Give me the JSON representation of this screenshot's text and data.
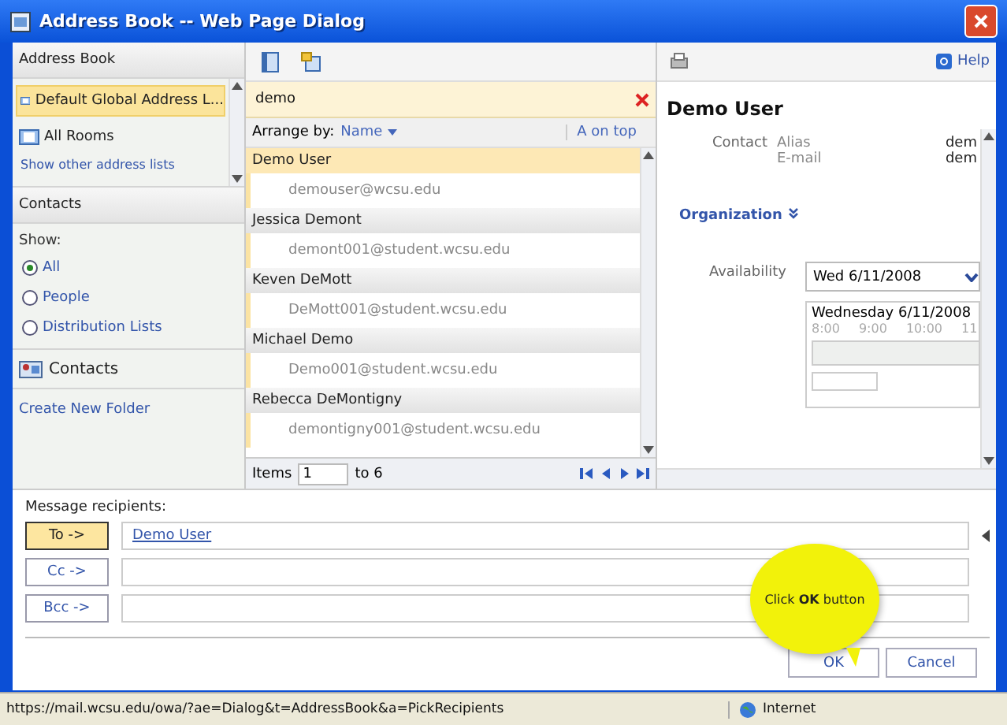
{
  "window": {
    "title": "Address Book -- Web Page Dialog"
  },
  "address_book": {
    "header": "Address Book",
    "lists": [
      {
        "label": "Default Global Address L...",
        "selected": true
      },
      {
        "label": "All Rooms",
        "selected": false
      }
    ],
    "more_link": "Show other address lists"
  },
  "contacts": {
    "header": "Contacts",
    "show_label": "Show:",
    "filters": [
      {
        "label": "All",
        "selected": true
      },
      {
        "label": "People",
        "selected": false
      },
      {
        "label": "Distribution Lists",
        "selected": false
      }
    ],
    "folder": "Contacts",
    "create_link": "Create New Folder"
  },
  "search": {
    "value": "demo"
  },
  "arrange": {
    "label": "Arrange by:",
    "field": "Name",
    "order": "A on top"
  },
  "results": [
    {
      "name": "Demo User",
      "email": "demouser@wcsu.edu",
      "selected": true
    },
    {
      "name": "Jessica Demont",
      "email": "demont001@student.wcsu.edu",
      "selected": false
    },
    {
      "name": "Keven DeMott",
      "email": "DeMott001@student.wcsu.edu",
      "selected": false
    },
    {
      "name": "Michael Demo",
      "email": "Demo001@student.wcsu.edu",
      "selected": false
    },
    {
      "name": "Rebecca DeMontigny",
      "email": "demontigny001@student.wcsu.edu",
      "selected": false
    }
  ],
  "pager": {
    "label": "Items",
    "value": "1",
    "range": "to 6"
  },
  "detail": {
    "help": "Help",
    "name": "Demo User",
    "contact_label": "Contact",
    "fields": [
      {
        "label": "Alias",
        "value": "dem"
      },
      {
        "label": "E-mail",
        "value": "dem"
      }
    ],
    "organization": "Organization",
    "availability_label": "Availability",
    "date": "Wed 6/11/2008",
    "day": "Wednesday 6/11/2008",
    "times": [
      "8:00",
      "9:00",
      "10:00",
      "11"
    ]
  },
  "recipients": {
    "label": "Message recipients:",
    "rows": [
      {
        "button": "To ->",
        "selected": true,
        "entries": [
          "Demo User"
        ]
      },
      {
        "button": "Cc ->",
        "selected": false
      },
      {
        "button": "Bcc ->",
        "selected": false
      }
    ]
  },
  "buttons": [
    {
      "label": "OK"
    },
    {
      "label": "Cancel"
    }
  ],
  "tooltip": {
    "text": "Click **OK** button"
  },
  "status_bar": {
    "url": "https://mail.wcsu.edu/owa/?ae=Dialog&t=AddressBook&a=PickRecipients",
    "zone": "Internet"
  }
}
